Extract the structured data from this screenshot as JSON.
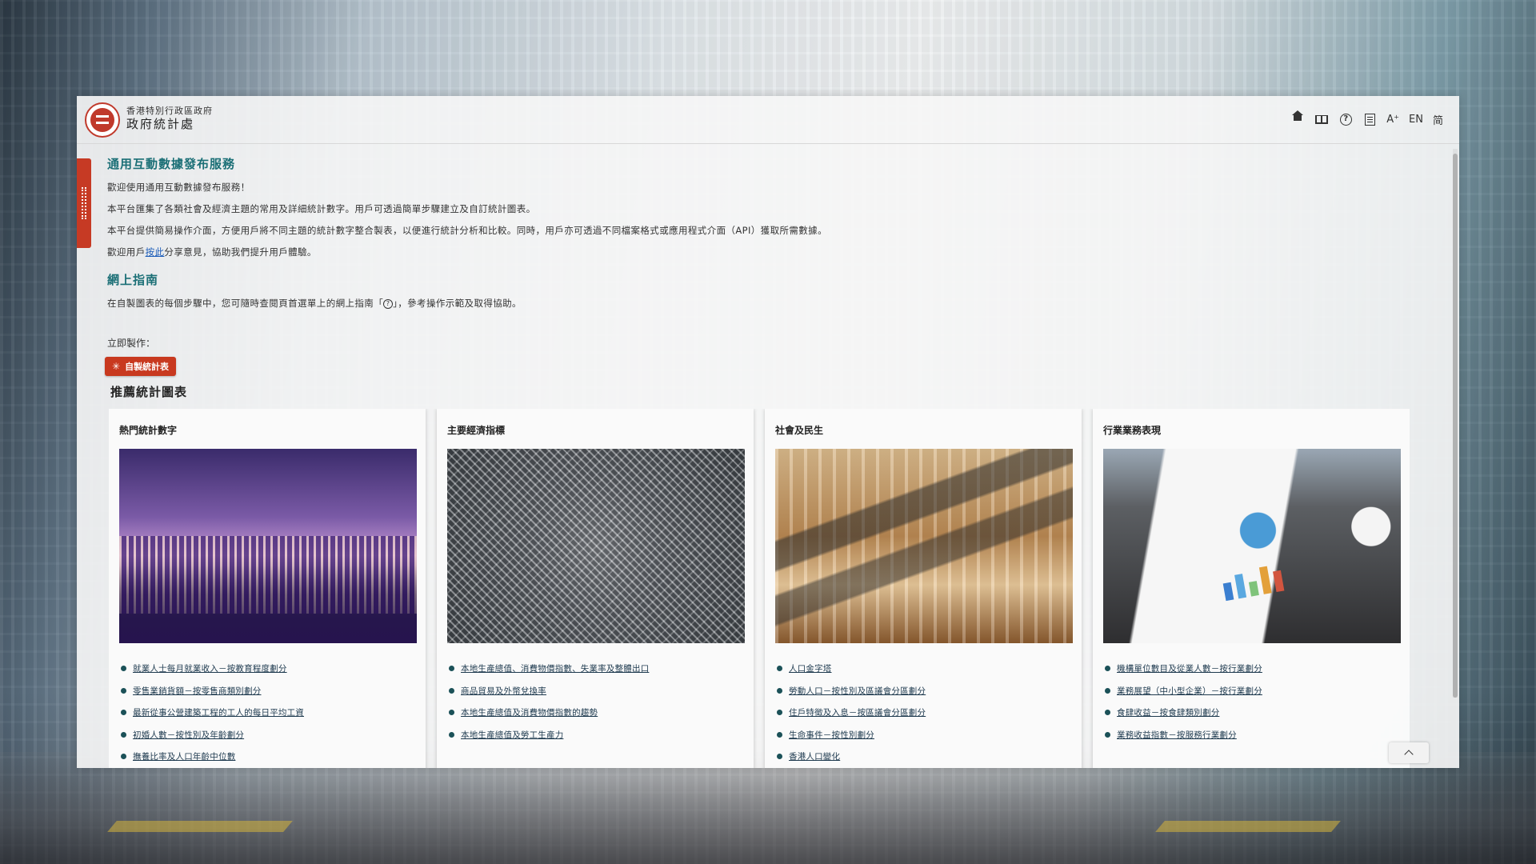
{
  "header": {
    "org_small": "香港特別行政區政府",
    "org_main": "政府統計處",
    "lang_en": "EN",
    "lang_sc": "简",
    "font_size": "A⁺"
  },
  "intro": {
    "title": "通用互動數據發布服務",
    "p1": "歡迎使用通用互動數據發布服務！",
    "p2": "本平台匯集了各類社會及經濟主題的常用及詳細統計數字。用戶可透過簡單步驟建立及自訂統計圖表。",
    "p3": "本平台提供簡易操作介面，方便用戶將不同主題的統計數字整合製表，以便進行統計分析和比較。同時，用戶亦可透過不同檔案格式或應用程式介面（API）獲取所需數據。",
    "p4_before": "歡迎用戶",
    "p4_link": "按此",
    "p4_after": "分享意見，協助我們提升用戶體驗。"
  },
  "guide": {
    "title": "網上指南",
    "text_before": "在自製圖表的每個步驟中，您可隨時查閱頁首選單上的網上指南「",
    "text_after": "」，參考操作示範及取得協助。"
  },
  "make": {
    "label": "立即製作：",
    "button": "自製統計表"
  },
  "recommend": {
    "title": "推薦統計圖表"
  },
  "cards": [
    {
      "title": "熱門統計數字",
      "image": "hong-kong-skyline-night",
      "links": [
        "就業人士每月就業收入－按教育程度劃分",
        "零售業銷貨額－按零售商類別劃分",
        "最新從事公營建築工程的工人的每日平均工資",
        "初婚人數－按性別及年齡劃分",
        "撫養比率及人口年齡中位數"
      ]
    },
    {
      "title": "主要經濟指標",
      "image": "aerial-city-view",
      "links": [
        "本地生產總值、消費物價指數、失業率及整體出口",
        "商品貿易及外幣兌換率",
        "本地生產總值及消費物價指數的趨勢",
        "本地生產總值及勞工生產力"
      ]
    },
    {
      "title": "社會及民生",
      "image": "shopping-mall-escalators",
      "links": [
        "人口金字塔",
        "勞動人口－按性別及區議會分區劃分",
        "住戶特徵及入息－按區議會分區劃分",
        "生命事件－按性別劃分",
        "香港人口變化"
      ]
    },
    {
      "title": "行業業務表現",
      "image": "business-charts-meeting",
      "links": [
        "機構單位數目及從業人數－按行業劃分",
        "業務展望（中小型企業）－按行業劃分",
        "食肆收益－按食肆類別劃分",
        "業務收益指數－按服務行業劃分"
      ]
    }
  ],
  "colors": {
    "accent_teal": "#1b6f76",
    "button_red": "#c8391f",
    "link_blue": "#1a5bb8"
  }
}
